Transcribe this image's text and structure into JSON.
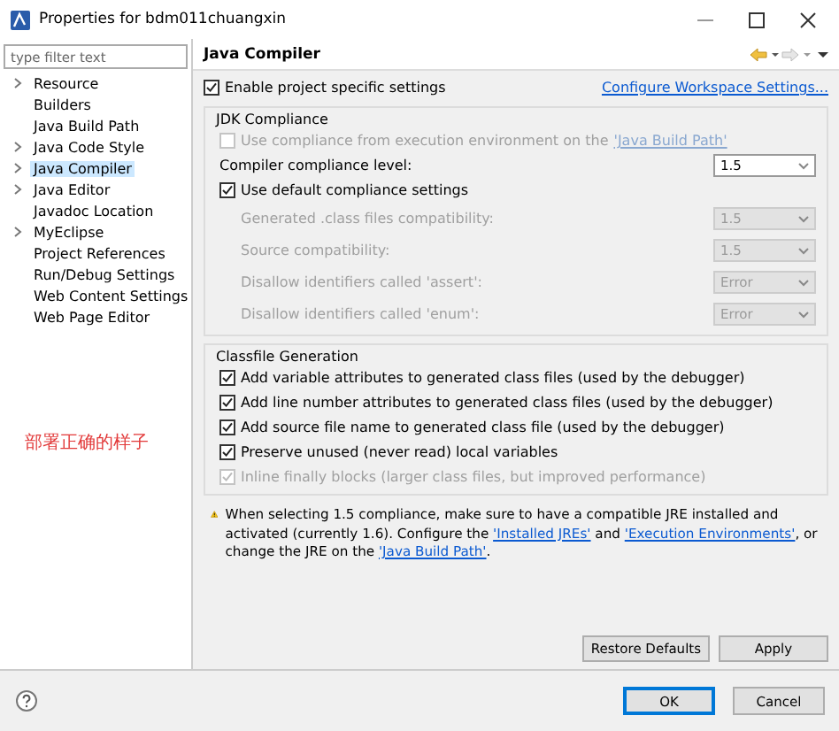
{
  "window": {
    "title": "Properties for bdm011chuangxin"
  },
  "filter": {
    "placeholder": "type filter text"
  },
  "sidebar": {
    "items": [
      {
        "label": "Resource",
        "kind": "expandable",
        "selected": false
      },
      {
        "label": "Builders",
        "kind": "leaf",
        "selected": false
      },
      {
        "label": "Java Build Path",
        "kind": "leaf",
        "selected": false
      },
      {
        "label": "Java Code Style",
        "kind": "expandable",
        "selected": false
      },
      {
        "label": "Java Compiler",
        "kind": "expandable",
        "selected": true
      },
      {
        "label": "Java Editor",
        "kind": "expandable",
        "selected": false
      },
      {
        "label": "Javadoc Location",
        "kind": "leaf",
        "selected": false
      },
      {
        "label": "MyEclipse",
        "kind": "expandable",
        "selected": false
      },
      {
        "label": "Project References",
        "kind": "leaf",
        "selected": false
      },
      {
        "label": "Run/Debug Settings",
        "kind": "leaf",
        "selected": false
      },
      {
        "label": "Web Content Settings",
        "kind": "leaf",
        "selected": false
      },
      {
        "label": "Web Page Editor",
        "kind": "leaf",
        "selected": false
      }
    ]
  },
  "annotation": "部署正确的样子",
  "page": {
    "title": "Java Compiler",
    "enable": {
      "label": "Enable project specific settings",
      "checked": true
    },
    "workspace_link": "Configure Workspace Settings...",
    "jdk": {
      "title": "JDK Compliance",
      "use_env": {
        "label": "Use compliance from execution environment on the ",
        "link": "'Java Build Path'",
        "checked": false,
        "disabled": true
      },
      "level": {
        "label": "Compiler compliance level:",
        "value": "1.5",
        "disabled": false
      },
      "use_default": {
        "label": "Use default compliance settings",
        "checked": true
      },
      "settings": [
        {
          "label": "Generated .class files compatibility:",
          "value": "1.5",
          "disabled": true
        },
        {
          "label": "Source compatibility:",
          "value": "1.5",
          "disabled": true
        },
        {
          "label": "Disallow identifiers called 'assert':",
          "value": "Error",
          "disabled": true
        },
        {
          "label": "Disallow identifiers called 'enum':",
          "value": "Error",
          "disabled": true
        }
      ]
    },
    "classfile": {
      "title": "Classfile Generation",
      "options": [
        {
          "label": "Add variable attributes to generated class files (used by the debugger)",
          "checked": true,
          "disabled": false
        },
        {
          "label": "Add line number attributes to generated class files (used by the debugger)",
          "checked": true,
          "disabled": false
        },
        {
          "label": "Add source file name to generated class file (used by the debugger)",
          "checked": true,
          "disabled": false
        },
        {
          "label": "Preserve unused (never read) local variables",
          "checked": true,
          "disabled": false
        },
        {
          "label": "Inline finally blocks (larger class files, but improved performance)",
          "checked": true,
          "disabled": true
        }
      ]
    },
    "warning": [
      {
        "kind": "text",
        "text": "When selecting 1.5 compliance, make sure to have a compatible JRE installed and activated (currently 1.6). Configure the "
      },
      {
        "kind": "link",
        "text": "'Installed JREs'"
      },
      {
        "kind": "text",
        "text": " and "
      },
      {
        "kind": "link",
        "text": "'Execution Environments'"
      },
      {
        "kind": "text",
        "text": ", or change the JRE on the "
      },
      {
        "kind": "link",
        "text": "'Java Build Path'"
      },
      {
        "kind": "text",
        "text": "."
      }
    ],
    "buttons": [
      "Restore Defaults",
      "Apply"
    ]
  },
  "footer": {
    "buttons": [
      {
        "label": "OK",
        "default": true
      },
      {
        "label": "Cancel",
        "default": false
      }
    ]
  }
}
